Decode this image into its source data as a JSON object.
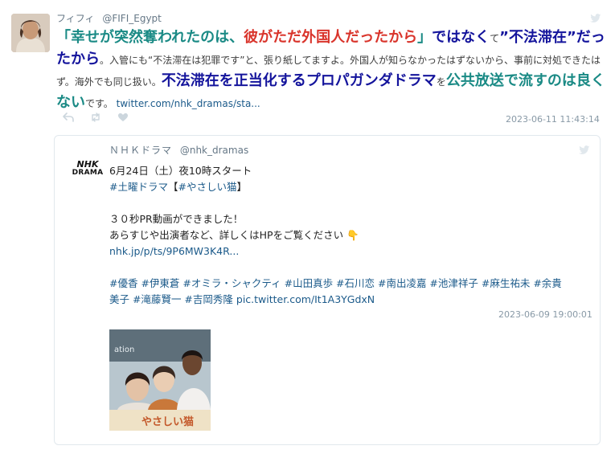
{
  "tweet": {
    "display_name": "フィフィ",
    "handle": "@FIFI_Egypt",
    "segments": [
      {
        "text": "「幸せが突然奪われたのは、",
        "style": "big teal"
      },
      {
        "text": "彼がただ外国人だったから",
        "style": "big red"
      },
      {
        "text": "」",
        "style": "big teal"
      },
      {
        "text": "ではなく",
        "style": "big navy"
      },
      {
        "text": "て",
        "style": ""
      },
      {
        "text": "”不法滞在”だったから",
        "style": "big navy"
      },
      {
        "text": "。入管にも“不法滞在は犯罪です”と、張り紙してますよ。外国人が知らなかったはずないから、事前に対処できたはず。海外でも同じ扱い。",
        "style": ""
      },
      {
        "text": "不法滞在を正当化するプロパガンダドラマ",
        "style": "big navy"
      },
      {
        "text": "を",
        "style": ""
      },
      {
        "text": "公共放送で流すのは良くない",
        "style": "big teal"
      },
      {
        "text": "です。 ",
        "style": ""
      },
      {
        "text": "twitter.com/nhk_dramas/sta...",
        "style": "link"
      }
    ],
    "timestamp": "2023-06-11 11:43:14",
    "icons": [
      "reply-icon",
      "retweet-icon",
      "like-icon",
      "twitter-bird-icon"
    ]
  },
  "quoted": {
    "display_name": "ＮＨＫドラマ",
    "handle": "@nhk_dramas",
    "logo": {
      "line1": "NHK",
      "line2": "DRAMA"
    },
    "lines": [
      [
        {
          "text": "6月24日（土）夜10時スタート",
          "style": ""
        }
      ],
      [
        {
          "text": "#土曜ドラマ",
          "style": "tag"
        },
        {
          "text": "【",
          "style": ""
        },
        {
          "text": "#やさしい猫",
          "style": "tag"
        },
        {
          "text": "】",
          "style": ""
        }
      ],
      [],
      [
        {
          "text": "３０秒PR動画ができました！",
          "style": ""
        }
      ],
      [
        {
          "text": "あらすじや出演者など、詳しくはHPをご覧ください 👇",
          "style": ""
        }
      ],
      [
        {
          "text": "nhk.jp/p/ts/9P6MW3K4R...",
          "style": "tag"
        }
      ],
      [],
      [
        {
          "text": "#優香 #伊東蒼 #オミラ・シャクティ #山田真歩 #石川恋 #南出凌嘉 #池津祥子 #麻生祐未 #余貴",
          "style": "tag"
        }
      ],
      [
        {
          "text": "美子 #滝藤賢一 #吉岡秀隆",
          "style": "tag"
        },
        {
          "text": " ",
          "style": ""
        },
        {
          "text": "pic.twitter.com/It1A3YGdxN",
          "style": "tag"
        }
      ]
    ],
    "timestamp": "2023-06-09 19:00:01",
    "thumbnail": {
      "station_text": "ation",
      "title_text": "やさしい猫"
    }
  }
}
